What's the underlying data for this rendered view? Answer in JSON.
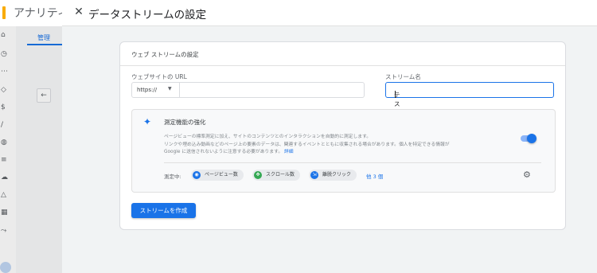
{
  "background": {
    "app_title": "アナリティ",
    "tab_label": "管理",
    "back_icon": "arrow-back-icon",
    "rail_icons": [
      "home-icon",
      "clock-icon",
      "share-icon",
      "tag-icon",
      "dollar-icon",
      "pen-icon",
      "globe-icon",
      "list-icon",
      "cloud-icon",
      "flask-icon",
      "grid-icon",
      "flow-icon",
      "gear-icon"
    ]
  },
  "panel": {
    "close_icon": "close-icon",
    "title": "データストリームの設定"
  },
  "card": {
    "header": "ウェブ ストリームの設定",
    "website_url_label": "ウェブサイトの URL",
    "protocol_value": "https://",
    "url_value": "",
    "stream_name_label": "ストリーム名",
    "stream_name_value": "テスト"
  },
  "enhanced": {
    "icon": "sparkle-icon",
    "title": "測定機能の強化",
    "description_line1": "ページビューの標準測定に加え、サイトのコンテンツとのインタラクションを自動的に測定します。",
    "description_line2": "リンクや埋め込み動画などのページ上の要素のデータは、関連するイベントとともに収集される場合があります。個人を特定できる情報が",
    "description_line3": "Google に送信されないように注意する必要があります。",
    "details_link": "詳細",
    "enabled": true,
    "measuring_label": "測定中:",
    "chips": [
      {
        "label": "ページビュー数",
        "icon": "eye-icon",
        "color": "#1a73e8"
      },
      {
        "label": "スクロール数",
        "icon": "scroll-icon",
        "color": "#34a853"
      },
      {
        "label": "離脱クリック",
        "icon": "exit-icon",
        "color": "#1a73e8"
      }
    ],
    "more_link": "他 3 個",
    "settings_icon": "gear-icon"
  },
  "actions": {
    "create_button": "ストリームを作成"
  }
}
